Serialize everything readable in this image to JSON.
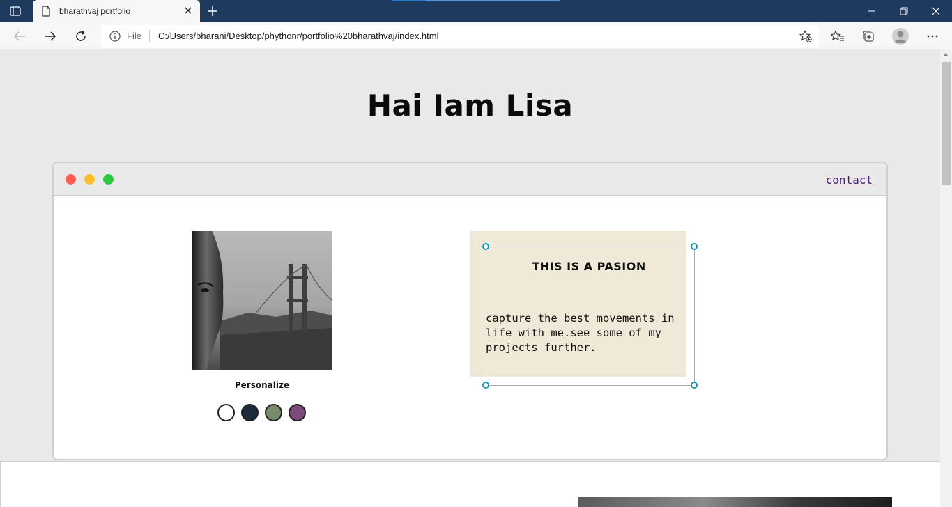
{
  "browser": {
    "tab_title": "bharathvaj portfolio",
    "address_scheme": "File",
    "url": "C:/Users/bharani/Desktop/phythonr/portfolio%20bharathvaj/index.html"
  },
  "page": {
    "heading": "Hai Iam Lisa",
    "nav": {
      "contact_label": "contact"
    },
    "profile": {
      "personalize_label": "Personalize",
      "swatch_colors": [
        "#ffffff",
        "#1d2b3a",
        "#778a6a",
        "#7a4a7a"
      ]
    },
    "intro": {
      "title": "THIS IS A PASION",
      "body": "capture the best movements in life with me.see some of my projects further."
    }
  },
  "colors": {
    "titlebar": "#1f3a5f",
    "page_background": "#e9e9e9",
    "intro_box": "#f1e9d8",
    "link": "#4b1f78",
    "handle": "#1797a8"
  }
}
